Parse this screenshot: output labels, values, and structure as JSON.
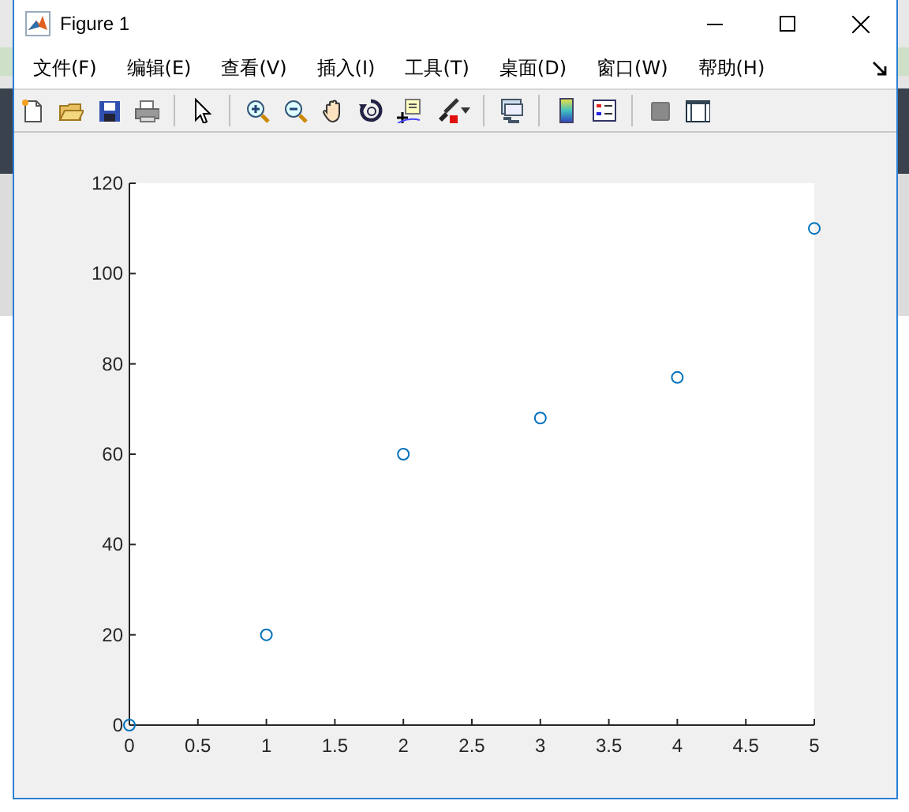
{
  "window": {
    "title": "Figure 1"
  },
  "menu": [
    {
      "label": "文件(F)"
    },
    {
      "label": "编辑(E)"
    },
    {
      "label": "查看(V)"
    },
    {
      "label": "插入(I)"
    },
    {
      "label": "工具(T)"
    },
    {
      "label": "桌面(D)"
    },
    {
      "label": "窗口(W)"
    },
    {
      "label": "帮助(H)"
    }
  ],
  "toolbar": [
    {
      "kind": "new"
    },
    {
      "kind": "open"
    },
    {
      "kind": "save"
    },
    {
      "kind": "print"
    },
    {
      "kind": "separator"
    },
    {
      "kind": "pointer"
    },
    {
      "kind": "separator"
    },
    {
      "kind": "zoom-in"
    },
    {
      "kind": "zoom-out"
    },
    {
      "kind": "pan"
    },
    {
      "kind": "rotate"
    },
    {
      "kind": "data-cursor"
    },
    {
      "kind": "brush"
    },
    {
      "kind": "separator"
    },
    {
      "kind": "link"
    },
    {
      "kind": "separator"
    },
    {
      "kind": "colorbar"
    },
    {
      "kind": "legend"
    },
    {
      "kind": "separator"
    },
    {
      "kind": "hide-tools"
    },
    {
      "kind": "show-tools"
    }
  ],
  "figure": {
    "chart_data": {
      "type": "scatter",
      "x": [
        0,
        1,
        2,
        3,
        4,
        5
      ],
      "series": [
        {
          "color": "#0072bd",
          "values": [
            0,
            20,
            60,
            68,
            77,
            110
          ]
        }
      ],
      "xlim": [
        0,
        5
      ],
      "ylim": [
        0,
        120
      ],
      "xticks": [
        0,
        0.5,
        1,
        1.5,
        2,
        2.5,
        3,
        3.5,
        4,
        4.5,
        5
      ],
      "yticks": [
        0,
        20,
        40,
        60,
        80,
        100,
        120
      ]
    }
  }
}
